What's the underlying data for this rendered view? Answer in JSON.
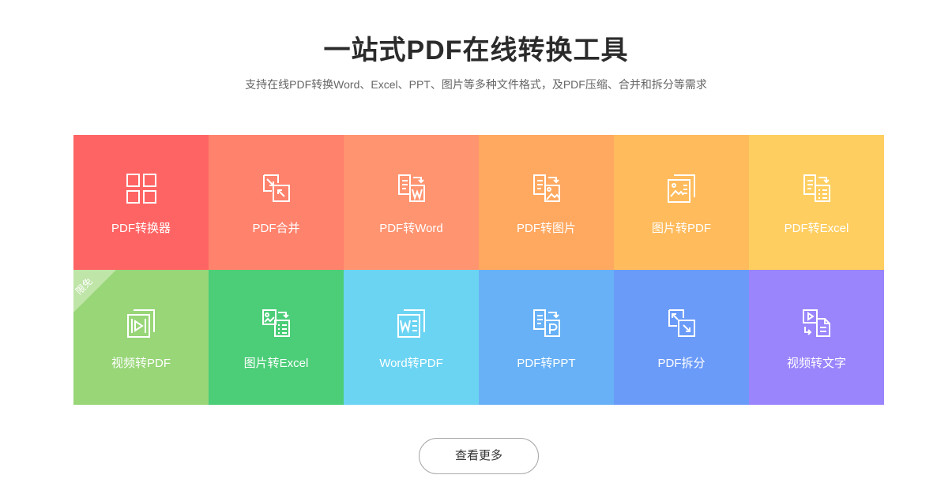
{
  "header": {
    "title": "一站式PDF在线转换工具",
    "subtitle": "支持在线PDF转换Word、Excel、PPT、图片等多种文件格式，及PDF压缩、合并和拆分等需求"
  },
  "tools": [
    {
      "label": "PDF转换器",
      "color": "#ff6464",
      "icon": "grid-icon"
    },
    {
      "label": "PDF合并",
      "color": "#ff826c",
      "icon": "merge-icon"
    },
    {
      "label": "PDF转Word",
      "color": "#ff9470",
      "icon": "pdf-to-word-icon"
    },
    {
      "label": "PDF转图片",
      "color": "#ffa860",
      "icon": "pdf-to-image-icon"
    },
    {
      "label": "图片转PDF",
      "color": "#ffbb5c",
      "icon": "image-to-pdf-icon"
    },
    {
      "label": "PDF转Excel",
      "color": "#ffce60",
      "icon": "pdf-to-excel-icon"
    },
    {
      "label": "视频转PDF",
      "color": "#98d678",
      "icon": "video-to-pdf-icon",
      "badge": "限免"
    },
    {
      "label": "图片转Excel",
      "color": "#4ccd78",
      "icon": "image-to-excel-icon"
    },
    {
      "label": "Word转PDF",
      "color": "#6cd4f3",
      "icon": "word-to-pdf-icon"
    },
    {
      "label": "PDF转PPT",
      "color": "#68b1f6",
      "icon": "pdf-to-ppt-icon"
    },
    {
      "label": "PDF拆分",
      "color": "#6b9bf9",
      "icon": "split-icon"
    },
    {
      "label": "视频转文字",
      "color": "#9a85fc",
      "icon": "video-to-text-icon"
    }
  ],
  "more_button": {
    "label": "查看更多"
  }
}
